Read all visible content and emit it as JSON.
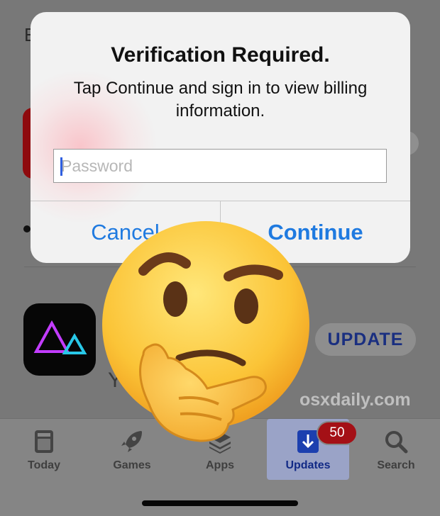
{
  "background": {
    "section_letter": "E",
    "partial_text": "Y",
    "update_button_label": "UPDATE",
    "watermark": "osxdaily.com"
  },
  "alert": {
    "title": "Verification Required.",
    "message": "Tap Continue and sign in to view billing information.",
    "password_placeholder": "Password",
    "password_value": "",
    "cancel_label": "Cancel",
    "continue_label": "Continue"
  },
  "tabbar": {
    "tabs": [
      {
        "label": "Today",
        "icon": "today-icon",
        "active": false
      },
      {
        "label": "Games",
        "icon": "rocket-icon",
        "active": false
      },
      {
        "label": "Apps",
        "icon": "layers-icon",
        "active": false
      },
      {
        "label": "Updates",
        "icon": "download-icon",
        "active": true
      },
      {
        "label": "Search",
        "icon": "search-icon",
        "active": false
      }
    ],
    "updates_badge": "50"
  },
  "colors": {
    "accent": "#1f7ae0",
    "badge": "#a41016",
    "active_tab_text": "#122a86"
  },
  "overlay": {
    "emoji": "thinking-face-emoji"
  }
}
